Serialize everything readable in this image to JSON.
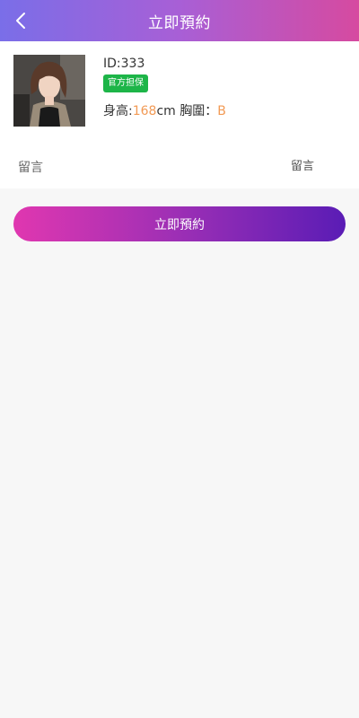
{
  "header": {
    "title": "立即預約",
    "back_icon": "chevron-left-icon"
  },
  "profile": {
    "id_text": "ID:333",
    "badge": "官方担保",
    "height_label": "身高:",
    "height_value": "168",
    "height_unit": "cm",
    "bust_label": " 胸圍：",
    "bust_value": "B"
  },
  "message": {
    "label": "留言",
    "placeholder": "留言"
  },
  "actions": {
    "book_label": "立即預約"
  },
  "colors": {
    "header_gradient": [
      "#7a6ee8",
      "#a85fd6",
      "#d64aa0"
    ],
    "badge": "#1db548",
    "highlight": "#f29a55",
    "button_gradient": [
      "#e037b0",
      "#9c2fb5",
      "#5a1cb5"
    ],
    "page_bg": "#f7f7f7"
  }
}
